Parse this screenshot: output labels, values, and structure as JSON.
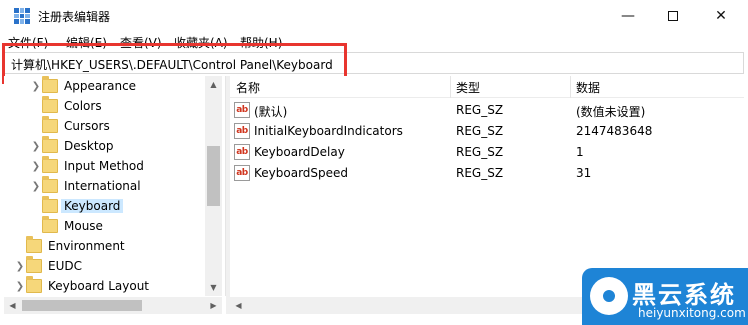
{
  "window": {
    "title": "注册表编辑器",
    "minimize_glyph": "—",
    "close_glyph": "✕"
  },
  "menu": {
    "items": [
      "文件(F)",
      "编辑(E)",
      "查看(V)",
      "收藏夹(A)",
      "帮助(H)"
    ]
  },
  "address": {
    "path": "计算机\\HKEY_USERS\\.DEFAULT\\Control Panel\\Keyboard",
    "highlight_color": "#e8352f"
  },
  "tree": {
    "items": [
      {
        "label": "Appearance",
        "expandable": true
      },
      {
        "label": "Colors",
        "expandable": false
      },
      {
        "label": "Cursors",
        "expandable": false
      },
      {
        "label": "Desktop",
        "expandable": true
      },
      {
        "label": "Input Method",
        "expandable": true
      },
      {
        "label": "International",
        "expandable": true
      },
      {
        "label": "Keyboard",
        "expandable": false,
        "selected": true
      },
      {
        "label": "Mouse",
        "expandable": false
      },
      {
        "label": "Environment",
        "expandable": false
      },
      {
        "label": "EUDC",
        "expandable": true
      },
      {
        "label": "Keyboard Layout",
        "expandable": true
      }
    ],
    "selected_color": "#cce8ff"
  },
  "list": {
    "columns": [
      "名称",
      "类型",
      "数据"
    ],
    "rows": [
      {
        "name": "(默认)",
        "type": "REG_SZ",
        "data": "(数值未设置)"
      },
      {
        "name": "InitialKeyboardIndicators",
        "type": "REG_SZ",
        "data": "2147483648"
      },
      {
        "name": "KeyboardDelay",
        "type": "REG_SZ",
        "data": "1"
      },
      {
        "name": "KeyboardSpeed",
        "type": "REG_SZ",
        "data": "31"
      }
    ],
    "value_icon": "ab-string-icon",
    "value_icon_text": "ab"
  },
  "watermark": {
    "title": "黑云系统",
    "subtitle": "heiyunxitong.com",
    "color": "#1e84d6"
  }
}
